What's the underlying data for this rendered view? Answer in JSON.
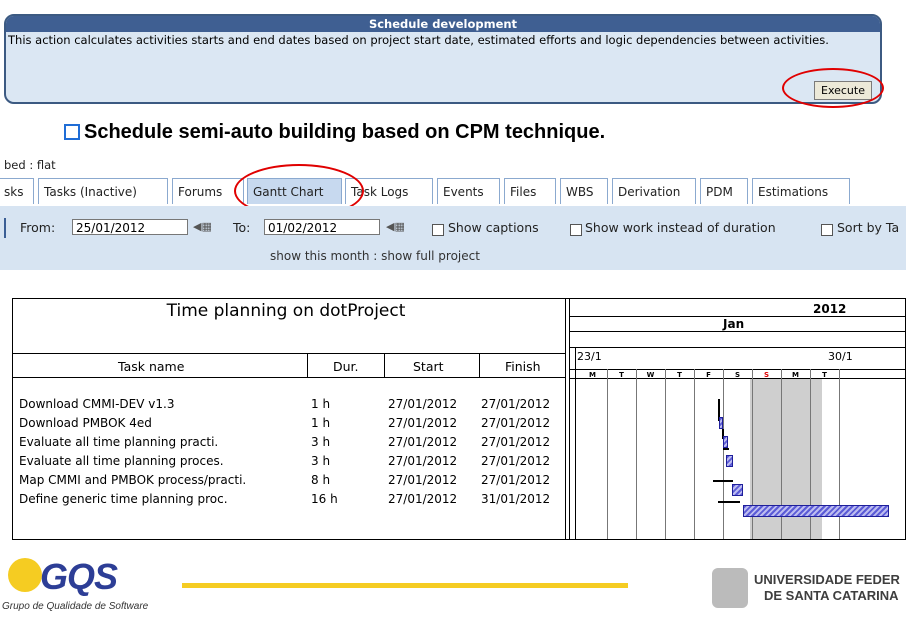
{
  "schedule": {
    "title": "Schedule development",
    "description": "This action calculates activities starts and end dates based on project start date, estimated efforts and logic dependencies between activities.",
    "execute_label": "Execute"
  },
  "heading": "Schedule semi-auto building based on CPM technique.",
  "crumb": "bed : flat",
  "tabs": [
    {
      "label": "sks",
      "active": false
    },
    {
      "label": "Tasks (Inactive)",
      "active": false
    },
    {
      "label": "Forums",
      "active": false
    },
    {
      "label": "Gantt Chart",
      "active": true
    },
    {
      "label": "Task Logs",
      "active": false
    },
    {
      "label": "Events",
      "active": false
    },
    {
      "label": "Files",
      "active": false
    },
    {
      "label": "WBS",
      "active": false
    },
    {
      "label": "Derivation",
      "active": false
    },
    {
      "label": "PDM",
      "active": false
    },
    {
      "label": "Estimations",
      "active": false
    }
  ],
  "filter": {
    "from_label": "From:",
    "from_value": "25/01/2012",
    "to_label": "To:",
    "to_value": "01/02/2012",
    "show_captions": "Show captions",
    "show_work": "Show work instead of duration",
    "sort_by": "Sort by Ta",
    "show_links": "show this month : show full project"
  },
  "gantt": {
    "title": "Time planning on dotProject",
    "year": "2012",
    "month": "Jan",
    "weeks": [
      "23/1",
      "30/1"
    ],
    "days": [
      "M",
      "T",
      "W",
      "T",
      "F",
      "S",
      "S",
      "M",
      "T"
    ],
    "columns": {
      "task": "Task name",
      "dur": "Dur.",
      "start": "Start",
      "finish": "Finish"
    },
    "tasks": [
      {
        "name": "Download CMMI-DEV v1.3",
        "dur": "1 h",
        "start": "27/01/2012",
        "finish": "27/01/2012"
      },
      {
        "name": "Download PMBOK 4ed",
        "dur": "1 h",
        "start": "27/01/2012",
        "finish": "27/01/2012"
      },
      {
        "name": "Evaluate all time planning practi.",
        "dur": "3 h",
        "start": "27/01/2012",
        "finish": "27/01/2012"
      },
      {
        "name": "Evaluate all time planning proces.",
        "dur": "3 h",
        "start": "27/01/2012",
        "finish": "27/01/2012"
      },
      {
        "name": "Map CMMI and PMBOK process/practi.",
        "dur": "8 h",
        "start": "27/01/2012",
        "finish": "27/01/2012"
      },
      {
        "name": "Define generic time planning proc.",
        "dur": "16 h",
        "start": "27/01/2012",
        "finish": "31/01/2012"
      }
    ]
  },
  "footer": {
    "gqs_logo": "GQS",
    "gqs_subtitle": "Grupo de Qualidade de Software",
    "ufsc_line1": "UNIVERSIDADE FEDER",
    "ufsc_line2": "DE SANTA CATARINA",
    "accent": "#f5cc22"
  }
}
